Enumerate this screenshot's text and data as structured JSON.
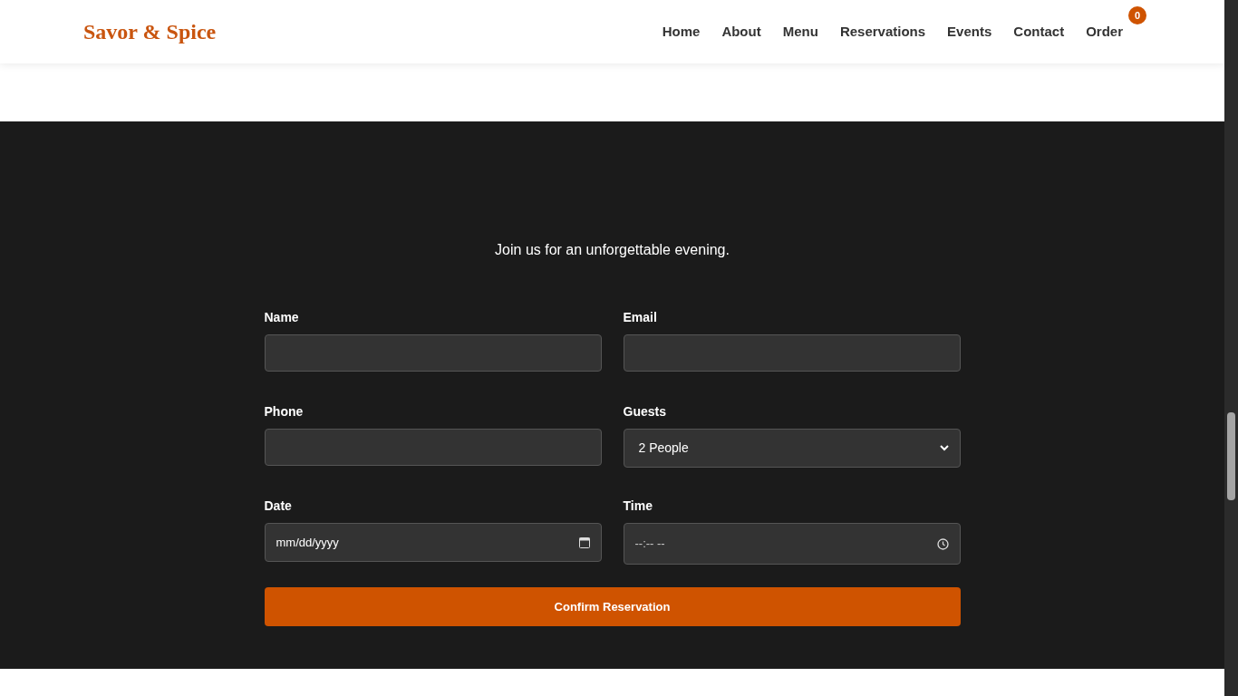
{
  "brand": "Savor & Spice",
  "nav": [
    {
      "label": "Home"
    },
    {
      "label": "About"
    },
    {
      "label": "Menu"
    },
    {
      "label": "Reservations"
    },
    {
      "label": "Events"
    },
    {
      "label": "Contact"
    },
    {
      "label": "Order",
      "badge": "0"
    }
  ],
  "intro": "Join us for an unforgettable evening.",
  "fields": [
    {
      "kind": "text",
      "label": "Name"
    },
    {
      "kind": "text",
      "label": "Email"
    },
    {
      "kind": "text",
      "label": "Phone"
    },
    {
      "kind": "select",
      "label": "Guests",
      "value": "2 People"
    },
    {
      "kind": "date",
      "label": "Date",
      "placeholder": "mm/dd/yyyy"
    },
    {
      "kind": "time",
      "label": "Time",
      "placeholder": "--:-- --"
    }
  ],
  "submit": "Confirm Reservation"
}
